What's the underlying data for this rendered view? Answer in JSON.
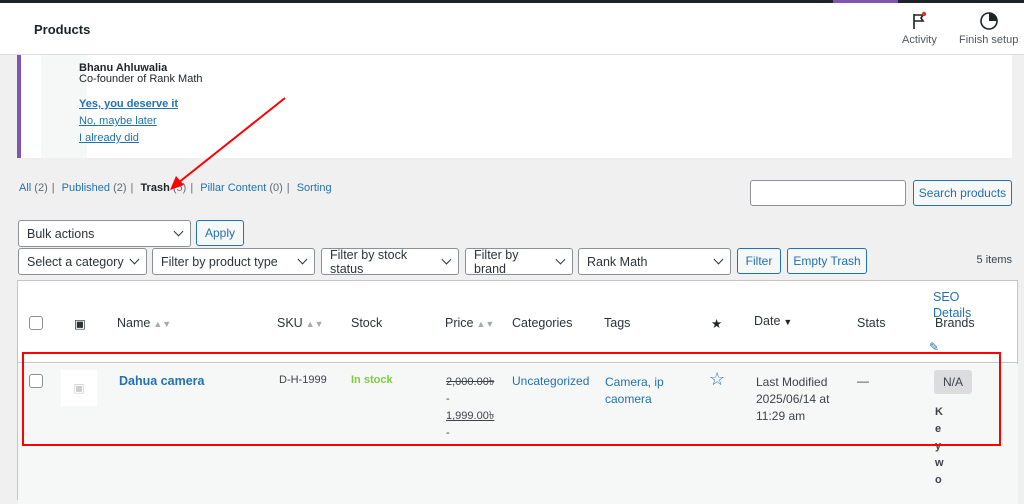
{
  "header": {
    "title": "Products",
    "activity": "Activity",
    "finish_setup": "Finish setup"
  },
  "notice": {
    "author": "Bhanu Ahluwalia",
    "role": "Co-founder of Rank Math",
    "links": [
      "Yes, you deserve it",
      "No, maybe later",
      "I already did"
    ]
  },
  "views": [
    {
      "label": "All",
      "count": "(2)"
    },
    {
      "label": "Published",
      "count": "(2)"
    },
    {
      "label": "Trash",
      "count": "(5)",
      "current": true
    },
    {
      "label": "Pillar Content",
      "count": "(0)"
    },
    {
      "label": "Sorting",
      "count": ""
    }
  ],
  "search": {
    "button": "Search products",
    "value": ""
  },
  "bulk": {
    "selected": "Bulk actions",
    "apply": "Apply"
  },
  "filters": {
    "category": "Select a category",
    "type": "Filter by product type",
    "stock": "Filter by stock status",
    "brand": "Filter by brand",
    "rankmath": "Rank Math",
    "filter": "Filter",
    "empty_trash": "Empty Trash"
  },
  "item_count": "5 items",
  "columns": {
    "name": "Name",
    "sku": "SKU",
    "stock": "Stock",
    "price": "Price",
    "categories": "Categories",
    "tags": "Tags",
    "date": "Date",
    "stats": "Stats",
    "seo": "SEO Details",
    "brands": "Brands"
  },
  "row": {
    "name": "Dahua camera",
    "sku": "D-H-1999",
    "stock": "In stock",
    "price_regular": "2,000.00৳",
    "price_sale": "1,999.00৳",
    "dash": "-",
    "category": "Uncategorized",
    "tags_line1": "Camera, ip",
    "tags_line2": "caomera",
    "date_status": "Last Modified",
    "date_value": "2025/06/14 at",
    "date_time": "11:29 am",
    "stats": "—",
    "brand": "N/A",
    "keyword_letters": [
      "K",
      "e",
      "y",
      "w",
      "o"
    ]
  },
  "colors": {
    "link": "#2271b1",
    "in_stock": "#7ad03a",
    "highlight": "#ff0000",
    "accent": "#7f54b3"
  }
}
